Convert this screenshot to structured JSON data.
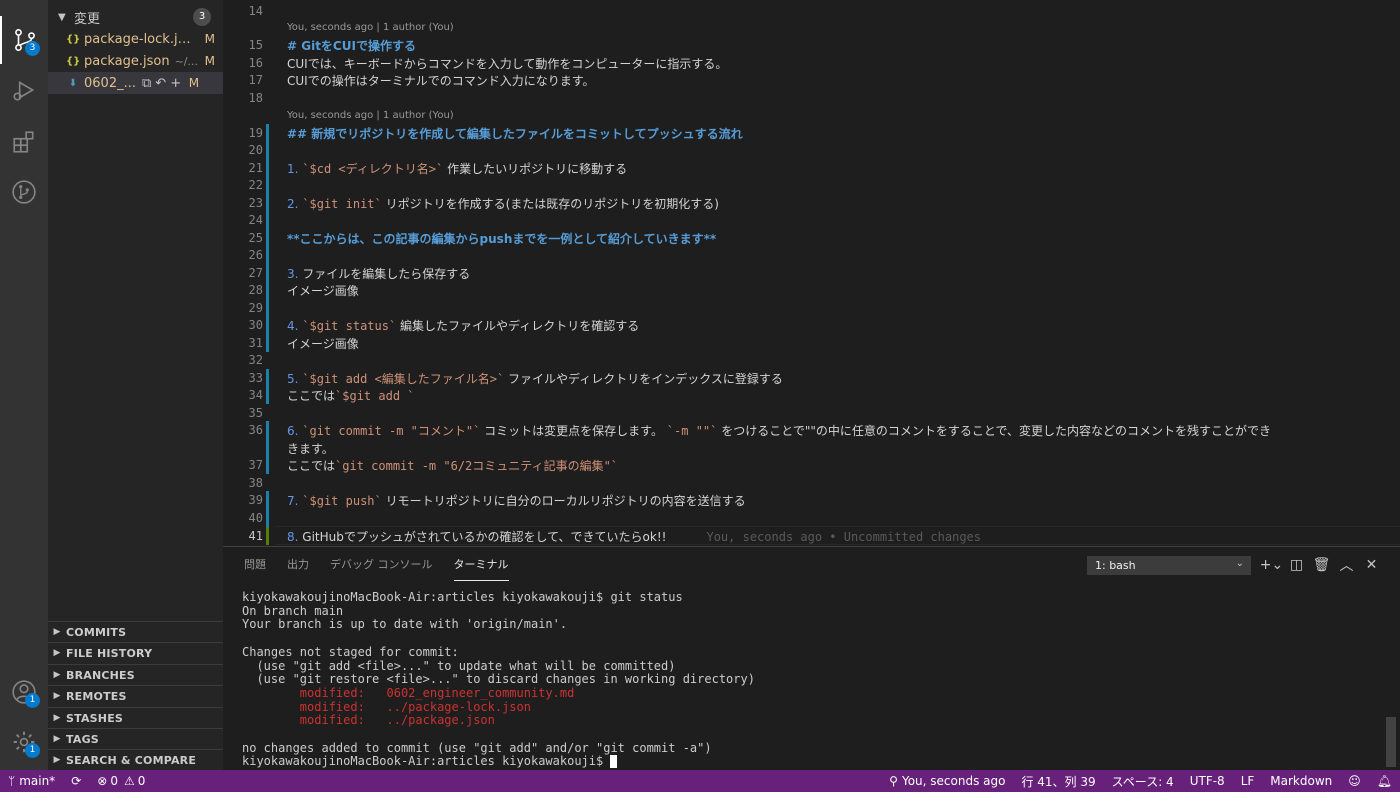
{
  "activity": {
    "scm_badge": "3",
    "accounts_badge": "1",
    "settings_badge": "1"
  },
  "sidebar": {
    "changes_title": "変更",
    "changes_count": "3",
    "files": [
      {
        "icon": "{}",
        "name": "package-lock.js...",
        "desc": "",
        "status": "M"
      },
      {
        "icon": "{}",
        "name": "package.json",
        "desc": "~/...",
        "status": "M"
      },
      {
        "icon": "⬇",
        "name": "0602_...",
        "desc": "",
        "status": "M"
      }
    ],
    "sections": [
      "COMMITS",
      "FILE HISTORY",
      "BRANCHES",
      "REMOTES",
      "STASHES",
      "TAGS",
      "SEARCH & COMPARE"
    ]
  },
  "editor": {
    "blame_top": "You, seconds ago | 1 author (You)",
    "blame_mid": "You, seconds ago | 1 author (You)",
    "lines": {
      "l14": "14",
      "l15": "15",
      "t15": "# GitをCUIで操作する",
      "l16": "16",
      "t16": "CUIでは、キーボードからコマンドを入力して動作をコンピューターに指示する。",
      "l17": "17",
      "t17": "CUIでの操作はターミナルでのコマンド入力になります。",
      "l18": "18",
      "l19": "19",
      "t19": "## 新規でリポジトリを作成して編集したファイルをコミットしてプッシュする流れ",
      "l20": "20",
      "l21": "21",
      "n21": "1.",
      "c21": "`$cd <ディレクトリ名>`",
      "t21": "作業したいリポジトリに移動する",
      "l22": "22",
      "l23": "23",
      "n23": "2.",
      "c23": "`$git init`",
      "t23": "リポジトリを作成する(または既存のリポジトリを初期化する)",
      "l24": "24",
      "l25": "25",
      "t25": "**ここからは、この記事の編集からpushまでを一例として紹介していきます**",
      "l26": "26",
      "l27": "27",
      "n27": "3.",
      "t27": "ファイルを編集したら保存する",
      "l28": "28",
      "t28": "イメージ画像",
      "l29": "29",
      "l30": "30",
      "n30": "4.",
      "c30": "`$git status`",
      "t30": "編集したファイルやディレクトリを確認する",
      "l31": "31",
      "t31": "イメージ画像",
      "l32": "32",
      "l33": "33",
      "n33": "5.",
      "c33": "`$git add <編集したファイル名>`",
      "t33": "ファイルやディレクトリをインデックスに登録する",
      "l34": "34",
      "t34a": "ここでは",
      "c34": "`$git add `",
      "l35": "35",
      "l36": "36",
      "n36": "6.",
      "c36": "`git commit -m \"コメント\"`",
      "t36a": "コミットは変更点を保存します。",
      "c36b": "`-m \"\"`",
      "t36b": "をつけることで\"\"の中に任意のコメントをすることで、変更した内容などのコメントを残すことができ",
      "t36c": "きます。",
      "l37": "37",
      "t37a": "ここでは",
      "c37": "`git commit -m \"6/2コミュニティ記事の編集\"`",
      "l38": "38",
      "l39": "39",
      "n39": "7.",
      "c39": "`$git push`",
      "t39": "リモートリポジトリに自分のローカルリポジトリの内容を送信する",
      "l40": "40",
      "l41": "41",
      "n41": "8.",
      "t41": "GitHubでプッシュがされているかの確認をして、できていたらok!!",
      "blame41": "You, seconds ago • Uncommitted changes"
    }
  },
  "panel": {
    "tabs": [
      "問題",
      "出力",
      "デバッグ コンソール",
      "ターミナル"
    ],
    "terminal_select": "1: bash",
    "terminal": {
      "t1": "kiyokawakoujinoMacBook-Air:articles kiyokawakouji$ git status",
      "t2": "On branch main",
      "t3": "Your branch is up to date with 'origin/main'.",
      "t4": "",
      "t5": "Changes not staged for commit:",
      "t6": "  (use \"git add <file>...\" to update what will be committed)",
      "t7": "  (use \"git restore <file>...\" to discard changes in working directory)",
      "t8": "        modified:   0602_engineer_community.md",
      "t9": "        modified:   ../package-lock.json",
      "t10": "        modified:   ../package.json",
      "t11": "",
      "t12": "no changes added to commit (use \"git add\" and/or \"git commit -a\")",
      "t13": "kiyokawakoujinoMacBook-Air:articles kiyokawakouji$ "
    }
  },
  "status": {
    "branch": "main*",
    "errors": "0",
    "warnings": "0",
    "blame": "You, seconds ago",
    "position": "行 41、列 39",
    "spaces": "スペース: 4",
    "encoding": "UTF-8",
    "eol": "LF",
    "language": "Markdown"
  }
}
